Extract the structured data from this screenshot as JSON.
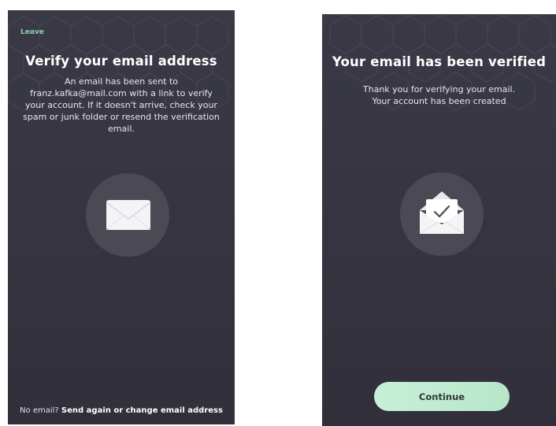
{
  "verify_screen": {
    "leave_label": "Leave",
    "title": "Verify your email address",
    "message": "An email has been sent to franz.kafka@mail.com with a link to verify your account. If it doesn't arrive, check your spam or junk folder or resend the verification email.",
    "footer_prefix": "No email?",
    "footer_link": "Send again or change email address",
    "icon": "envelope-closed-icon"
  },
  "verified_screen": {
    "title": "Your email has been verified",
    "message_line1": "Thank you for verifying your email.",
    "message_line2": "Your account has been created",
    "continue_label": "Continue",
    "icon": "envelope-open-check-icon"
  },
  "colors": {
    "background": "#363541",
    "accent_green": "#7fd6a4",
    "button_fill": "#c1ecd2",
    "circle": "#4a4954"
  }
}
